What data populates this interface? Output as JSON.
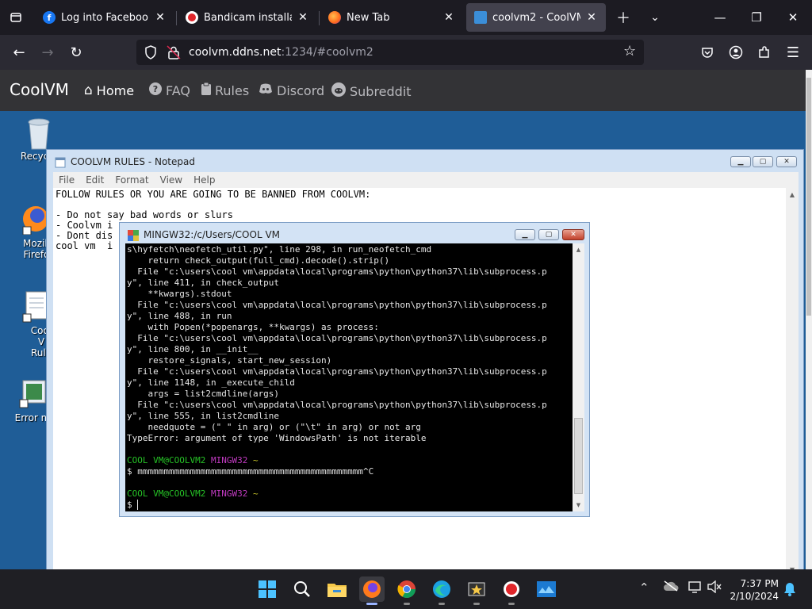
{
  "browser": {
    "tabs": [
      {
        "title": "Log into Facebook | Fa",
        "favicon": "facebook-icon"
      },
      {
        "title": "Bandicam installation c",
        "favicon": "bandicam-icon"
      },
      {
        "title": "New Tab",
        "favicon": "firefox-icon"
      },
      {
        "title": "coolvm2 - CoolVM",
        "favicon": "coolvm-icon",
        "active": true
      }
    ],
    "url_host": "coolvm.ddns.net",
    "url_path": ":1234/#coolvm2"
  },
  "site": {
    "brand": "CoolVM",
    "nav": [
      {
        "label": "Home",
        "icon": "home-icon"
      },
      {
        "label": "FAQ",
        "icon": "question-icon"
      },
      {
        "label": "Rules",
        "icon": "clipboard-icon"
      },
      {
        "label": "Discord",
        "icon": "discord-icon"
      },
      {
        "label": "Subreddit",
        "icon": "reddit-icon"
      }
    ]
  },
  "desktop": {
    "icons": [
      {
        "label": "Recycle"
      },
      {
        "label": "Mozill Firefo"
      },
      {
        "label": "Cool V Rule"
      },
      {
        "label": "Error m"
      }
    ]
  },
  "notepad": {
    "title": "COOLVM RULES - Notepad",
    "menu": [
      "File",
      "Edit",
      "Format",
      "View",
      "Help"
    ],
    "text": "FOLLOW RULES OR YOU ARE GOING TO BE BANNED FROM COOLVM:\n\n- Do not say bad words or slurs\n- Coolvm i\n- Dont dis\ncool vm  i"
  },
  "terminal": {
    "title": "MINGW32:/c/Users/COOL VM",
    "trace": "s\\hyfetch\\neofetch_util.py\", line 298, in run_neofetch_cmd\n    return check_output(full_cmd).decode().strip()\n  File \"c:\\users\\cool vm\\appdata\\local\\programs\\python\\python37\\lib\\subprocess.p\ny\", line 411, in check_output\n    **kwargs).stdout\n  File \"c:\\users\\cool vm\\appdata\\local\\programs\\python\\python37\\lib\\subprocess.p\ny\", line 488, in run\n    with Popen(*popenargs, **kwargs) as process:\n  File \"c:\\users\\cool vm\\appdata\\local\\programs\\python\\python37\\lib\\subprocess.p\ny\", line 800, in __init__\n    restore_signals, start_new_session)\n  File \"c:\\users\\cool vm\\appdata\\local\\programs\\python\\python37\\lib\\subprocess.p\ny\", line 1148, in _execute_child\n    args = list2cmdline(args)\n  File \"c:\\users\\cool vm\\appdata\\local\\programs\\python\\python37\\lib\\subprocess.p\ny\", line 555, in list2cmdline\n    needquote = (\" \" in arg) or (\"\\t\" in arg) or not arg\nTypeError: argument of type 'WindowsPath' is not iterable",
    "prompt_user": "COOL VM@COOLVM2",
    "prompt_shell": "MINGW32",
    "prompt_dir": "~",
    "cmd1": "$ mmmmmmmmmmmmmmmmmmmmmmmmmmmmmmmmmmmmmmmmmmm^C",
    "cmd2": "$ "
  },
  "taskbar": {
    "time": "7:37 PM",
    "date": "2/10/2024"
  }
}
